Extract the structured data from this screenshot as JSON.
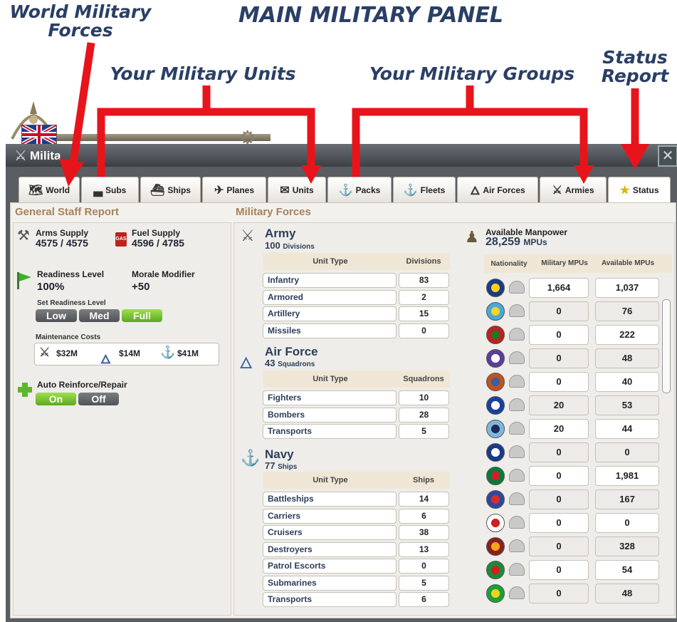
{
  "annotations": {
    "main_title": "MAIN MILITARY PANEL",
    "world_forces": "World Military Forces",
    "units": "Your Military Units",
    "groups": "Your Military Groups",
    "status": "Status Report"
  },
  "window": {
    "title": "Milita"
  },
  "tabs": [
    {
      "label": "World",
      "icon": "world-map-icon"
    },
    {
      "label": "Subs",
      "icon": "submarine-icon"
    },
    {
      "label": "Ships",
      "icon": "ship-icon"
    },
    {
      "label": "Planes",
      "icon": "plane-icon"
    },
    {
      "label": "Units",
      "icon": "envelope-icon"
    },
    {
      "label": "Packs",
      "icon": "anchor-ship-icon"
    },
    {
      "label": "Fleets",
      "icon": "anchor-icon"
    },
    {
      "label": "Air Forces",
      "icon": "wings-icon"
    },
    {
      "label": "Armies",
      "icon": "crossed-swords-icon"
    },
    {
      "label": "Status",
      "icon": "stars-icon"
    }
  ],
  "staff": {
    "heading": "General Staff Report",
    "arms_label": "Arms Supply",
    "arms_value": "4575 / 4575",
    "fuel_label": "Fuel Supply",
    "fuel_value": "4596 / 4785",
    "fuel_badge": "GAS",
    "readiness_label": "Readiness Level",
    "readiness_value": "100%",
    "morale_label": "Morale Modifier",
    "morale_value": "+50",
    "set_readiness_label": "Set Readiness Level",
    "readiness_buttons": [
      "Low",
      "Med",
      "Full"
    ],
    "maint_label": "Maintenance Costs",
    "costs": [
      "$32M",
      "$14M",
      "$41M"
    ],
    "auto_label": "Auto Reinforce/Repair",
    "auto_buttons": [
      "On",
      "Off"
    ]
  },
  "forces": {
    "heading": "Military Forces",
    "army": {
      "name": "Army",
      "count": "100",
      "unit": "Divisions",
      "col1": "Unit Type",
      "col2": "Divisions",
      "rows": [
        [
          "Infantry",
          "83"
        ],
        [
          "Armored",
          "2"
        ],
        [
          "Artillery",
          "15"
        ],
        [
          "Missiles",
          "0"
        ]
      ]
    },
    "airforce": {
      "name": "Air Force",
      "count": "43",
      "unit": "Squadrons",
      "col1": "Unit Type",
      "col2": "Squadrons",
      "rows": [
        [
          "Fighters",
          "10"
        ],
        [
          "Bombers",
          "28"
        ],
        [
          "Transports",
          "5"
        ]
      ]
    },
    "navy": {
      "name": "Navy",
      "count": "77",
      "unit": "Ships",
      "col1": "Unit Type",
      "col2": "Ships",
      "rows": [
        [
          "Battleships",
          "14"
        ],
        [
          "Carriers",
          "6"
        ],
        [
          "Cruisers",
          "38"
        ],
        [
          "Destroyers",
          "13"
        ],
        [
          "Patrol Escorts",
          "0"
        ],
        [
          "Submarines",
          "5"
        ],
        [
          "Transports",
          "6"
        ]
      ]
    }
  },
  "manpower": {
    "label": "Available Manpower",
    "value": "28,259",
    "unit": "MPUs",
    "col_nat": "Nationality",
    "col_mil": "Military MPUs",
    "col_avail": "Available MPUs",
    "rows": [
      {
        "mil": "1,664",
        "avail": "1,037",
        "flag": [
          "#1a3a8a",
          "#ffd200"
        ]
      },
      {
        "mil": "0",
        "avail": "76",
        "flag": [
          "#4aa8d8",
          "#f2d32a"
        ]
      },
      {
        "mil": "0",
        "avail": "222",
        "flag": [
          "#c0201f",
          "#1b7a2a"
        ]
      },
      {
        "mil": "0",
        "avail": "48",
        "flag": [
          "#5a3f9a",
          "#ffffff"
        ]
      },
      {
        "mil": "0",
        "avail": "40",
        "flag": [
          "#c0521f",
          "#3a5fa0"
        ]
      },
      {
        "mil": "20",
        "avail": "53",
        "flag": [
          "#1a3fa0",
          "#ffffff"
        ]
      },
      {
        "mil": "20",
        "avail": "44",
        "flag": [
          "#7fb6e0",
          "#1a2a5a"
        ]
      },
      {
        "mil": "0",
        "avail": "0",
        "flag": [
          "#1a3a8a",
          "#ffffff"
        ]
      },
      {
        "mil": "0",
        "avail": "1,981",
        "flag": [
          "#0a7a3a",
          "#d01f2a"
        ]
      },
      {
        "mil": "0",
        "avail": "167",
        "flag": [
          "#2a4aa0",
          "#e02a2a"
        ]
      },
      {
        "mil": "0",
        "avail": "0",
        "flag": [
          "#ffffff",
          "#d01f1f"
        ]
      },
      {
        "mil": "0",
        "avail": "328",
        "flag": [
          "#8a1f1f",
          "#f2a51a"
        ]
      },
      {
        "mil": "0",
        "avail": "54",
        "flag": [
          "#1a8a3a",
          "#d01f1f"
        ]
      },
      {
        "mil": "0",
        "avail": "48",
        "flag": [
          "#1aa03a",
          "#f2d31a"
        ]
      }
    ]
  },
  "colors": {
    "arrow": "#e8141c",
    "annotation": "#2a3f66",
    "section_heading": "#a8825a"
  }
}
